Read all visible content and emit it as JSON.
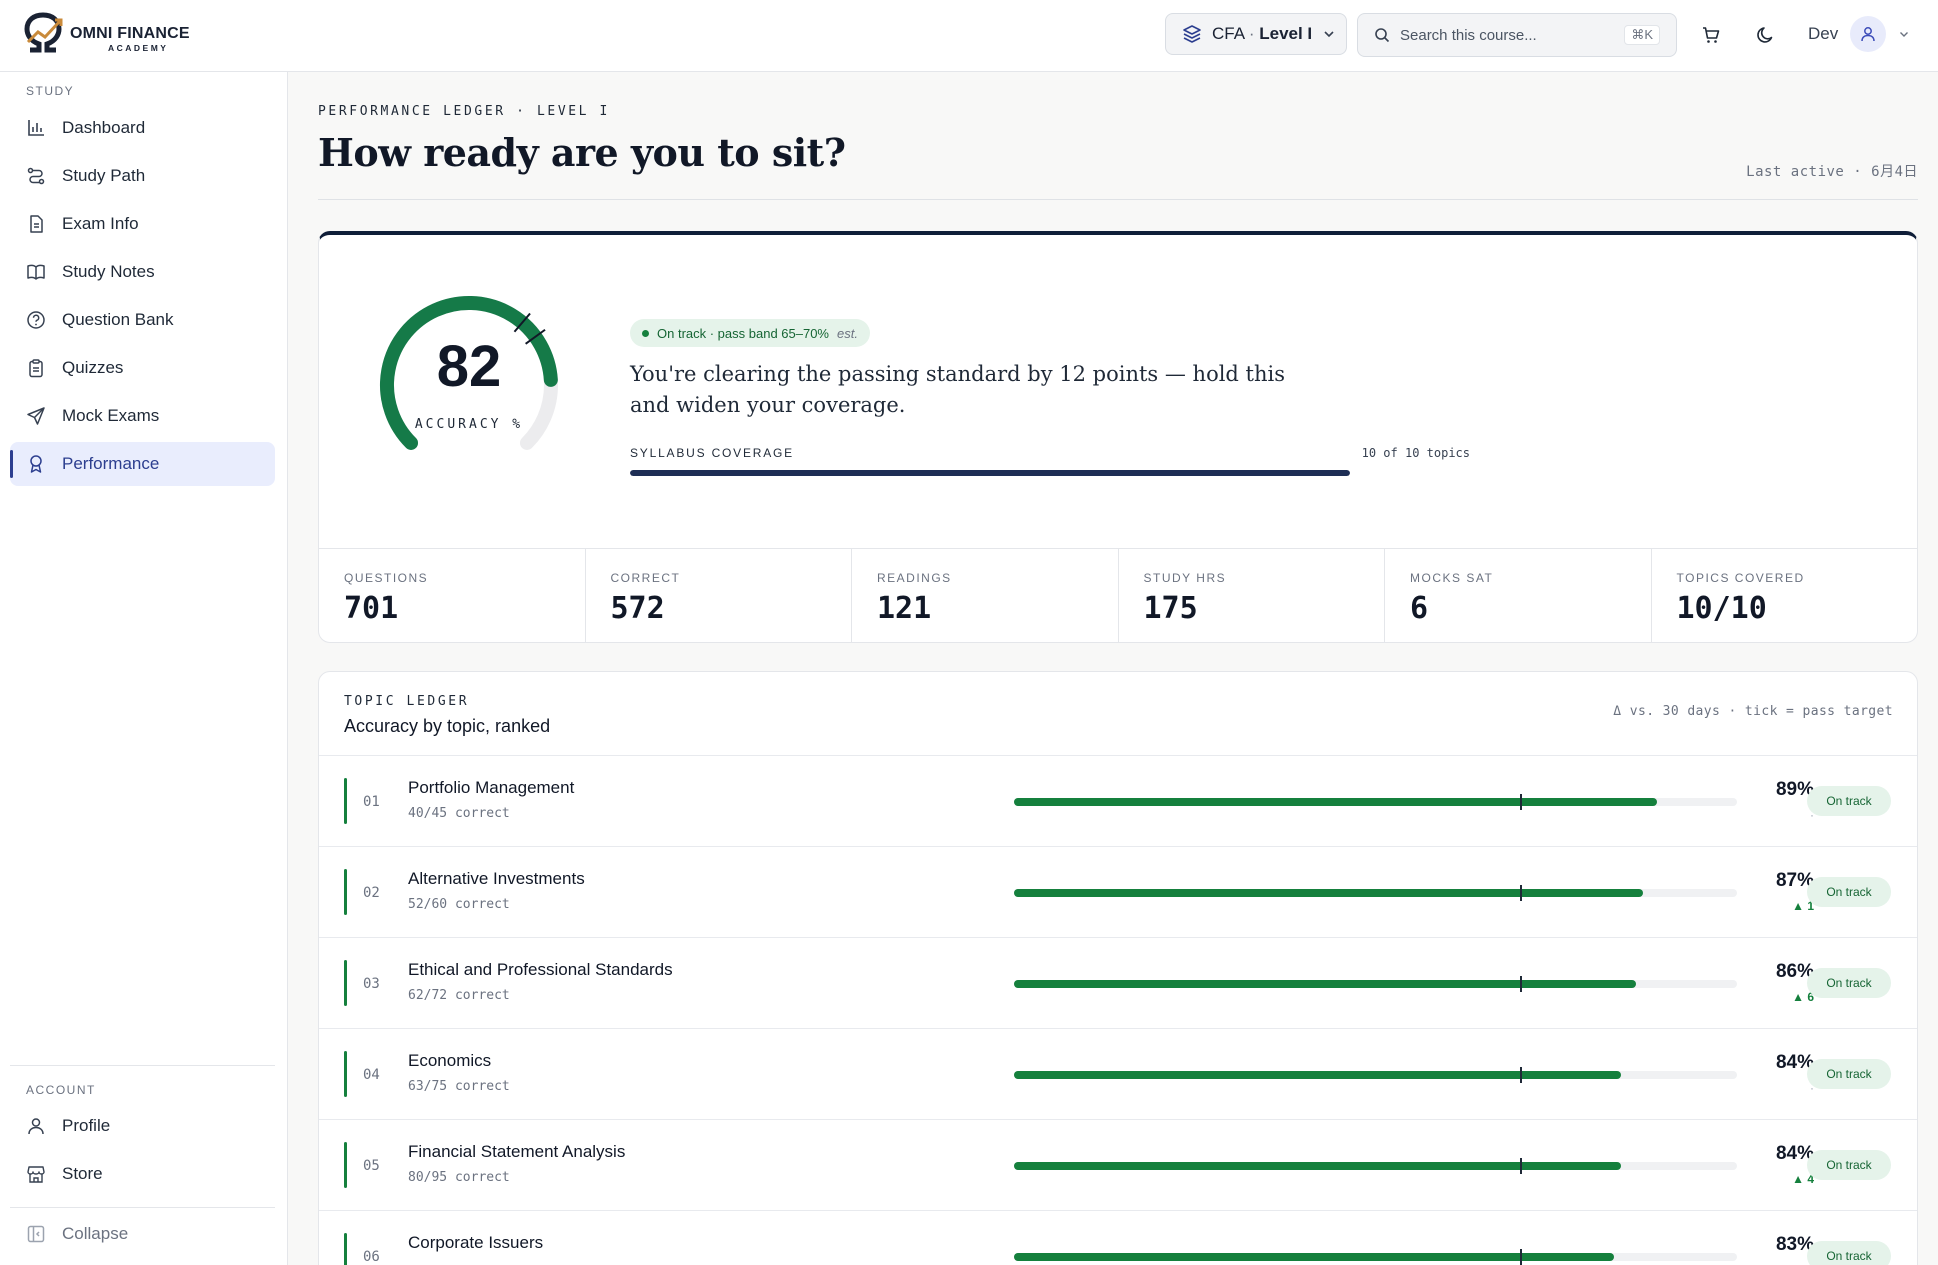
{
  "header": {
    "logo": {
      "name": "OMNI FINANCE",
      "sub": "ACADEMY"
    },
    "course": {
      "program": "CFA",
      "separator": " · ",
      "level": "Level I"
    },
    "search": {
      "placeholder": "Search this course...",
      "shortcut": "⌘K"
    },
    "user": {
      "name": "Dev"
    }
  },
  "sidebar": {
    "section_study": "STUDY",
    "items": [
      {
        "label": "Dashboard",
        "icon": "bar-chart-icon"
      },
      {
        "label": "Study Path",
        "icon": "route-icon"
      },
      {
        "label": "Exam Info",
        "icon": "document-icon"
      },
      {
        "label": "Study Notes",
        "icon": "book-icon"
      },
      {
        "label": "Question Bank",
        "icon": "question-circle-icon"
      },
      {
        "label": "Quizzes",
        "icon": "clipboard-icon"
      },
      {
        "label": "Mock Exams",
        "icon": "send-icon"
      },
      {
        "label": "Performance",
        "icon": "award-icon",
        "active": true
      }
    ],
    "section_account": "ACCOUNT",
    "account_items": [
      {
        "label": "Profile",
        "icon": "user-icon"
      },
      {
        "label": "Store",
        "icon": "store-icon"
      }
    ],
    "collapse_label": "Collapse"
  },
  "page": {
    "eyebrow": "PERFORMANCE LEDGER · LEVEL I",
    "title": "How ready are you to sit?",
    "last_active": "Last active · 6月4日"
  },
  "readiness": {
    "accuracy": 82,
    "accuracy_label": "ACCURACY %",
    "pass_band": [
      65,
      70
    ],
    "status": "On track · pass band 65–70%",
    "status_est": "est.",
    "message": "You're clearing the passing standard by 12 points — hold this and widen your coverage.",
    "coverage_label": "SYLLABUS COVERAGE",
    "coverage_count": "10 of 10 topics",
    "coverage_fraction": 1.0
  },
  "stats": [
    {
      "label": "QUESTIONS",
      "value": "701"
    },
    {
      "label": "CORRECT",
      "value": "572"
    },
    {
      "label": "READINGS",
      "value": "121"
    },
    {
      "label": "STUDY HRS",
      "value": "175"
    },
    {
      "label": "MOCKS SAT",
      "value": "6"
    },
    {
      "label": "TOPICS COVERED",
      "value": "10/10"
    }
  ],
  "ledger": {
    "eyebrow": "TOPIC LEDGER",
    "title": "Accuracy by topic, ranked",
    "note": "Δ vs. 30 days · tick = pass target",
    "pass_target": 70,
    "topics": [
      {
        "rank": "01",
        "name": "Portfolio Management",
        "detail": "40/45 correct",
        "pct": 89,
        "pct_label": "89%",
        "delta": "·",
        "status": "On track"
      },
      {
        "rank": "02",
        "name": "Alternative Investments",
        "detail": "52/60 correct",
        "pct": 87,
        "pct_label": "87%",
        "delta": "▲ 1",
        "status": "On track"
      },
      {
        "rank": "03",
        "name": "Ethical and Professional Standards",
        "detail": "62/72 correct",
        "pct": 86,
        "pct_label": "86%",
        "delta": "▲ 6",
        "status": "On track"
      },
      {
        "rank": "04",
        "name": "Economics",
        "detail": "63/75 correct",
        "pct": 84,
        "pct_label": "84%",
        "delta": "·",
        "status": "On track"
      },
      {
        "rank": "05",
        "name": "Financial Statement Analysis",
        "detail": "80/95 correct",
        "pct": 84,
        "pct_label": "84%",
        "delta": "▲ 4",
        "status": "On track"
      },
      {
        "rank": "06",
        "name": "Corporate Issuers",
        "detail": "",
        "pct": 83,
        "pct_label": "83%",
        "delta": "",
        "status": "On track"
      }
    ]
  },
  "colors": {
    "accent": "#15803d",
    "brand": "#2c3e8f",
    "navy": "#0f1e38"
  }
}
